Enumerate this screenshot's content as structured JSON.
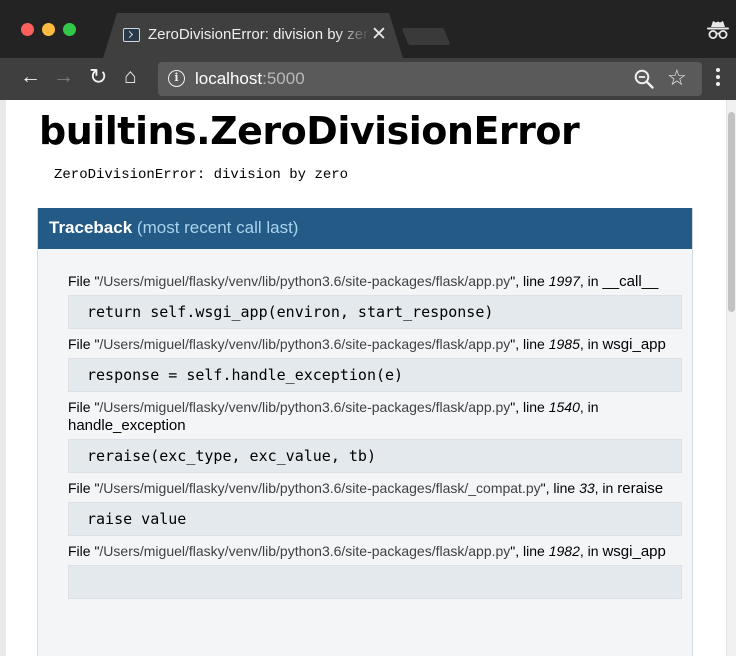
{
  "browser": {
    "tab": {
      "title": "ZeroDivisionError: division by zero",
      "close": "✕"
    },
    "toolbar": {
      "back": "←",
      "forward": "→",
      "reload": "↻",
      "home": "⌂",
      "url_host": "localhost",
      "url_port": ":5000",
      "star": "☆"
    },
    "icons": {
      "favicon": "terminal-icon",
      "incognito": "incognito-icon",
      "info": "info-icon",
      "zoom": "zoom-out-icon",
      "menu": "kebab-menu-icon"
    },
    "colors": {
      "tabstrip": "#232323",
      "toolbar": "#3f3f3f",
      "omnibox": "#5a5a5a"
    }
  },
  "page": {
    "title": "builtins.ZeroDivisionError",
    "message": "ZeroDivisionError: division by zero",
    "traceback": {
      "label": "Traceback",
      "hint": "(most recent call last)",
      "header_color": "#245b86",
      "frames": [
        {
          "file_prefix": "File \"",
          "path": "/Users/miguel/flasky/venv/lib/python3.6/site-packages/flask/app.py",
          "mid": "\", line ",
          "line": "1997",
          "in": ", in ",
          "func": "__call__",
          "code": "return self.wsgi_app(environ, start_response)"
        },
        {
          "file_prefix": "File \"",
          "path": "/Users/miguel/flasky/venv/lib/python3.6/site-packages/flask/app.py",
          "mid": "\", line ",
          "line": "1985",
          "in": ", in ",
          "func": "wsgi_app",
          "code": "response = self.handle_exception(e)"
        },
        {
          "file_prefix": "File \"",
          "path": "/Users/miguel/flasky/venv/lib/python3.6/site-packages/flask/app.py",
          "mid": "\", line ",
          "line": "1540",
          "in": ", in ",
          "func": "handle_exception",
          "code": "reraise(exc_type, exc_value, tb)"
        },
        {
          "file_prefix": "File \"",
          "path": "/Users/miguel/flasky/venv/lib/python3.6/site-packages/flask/_compat.py",
          "mid": "\", line ",
          "line": "33",
          "in": ", in ",
          "func": "reraise",
          "code": "raise value"
        },
        {
          "file_prefix": "File \"",
          "path": "/Users/miguel/flasky/venv/lib/python3.6/site-packages/flask/app.py",
          "mid": "\", line ",
          "line": "1982",
          "in": ", in ",
          "func": "wsgi_app",
          "code": ""
        }
      ]
    }
  }
}
